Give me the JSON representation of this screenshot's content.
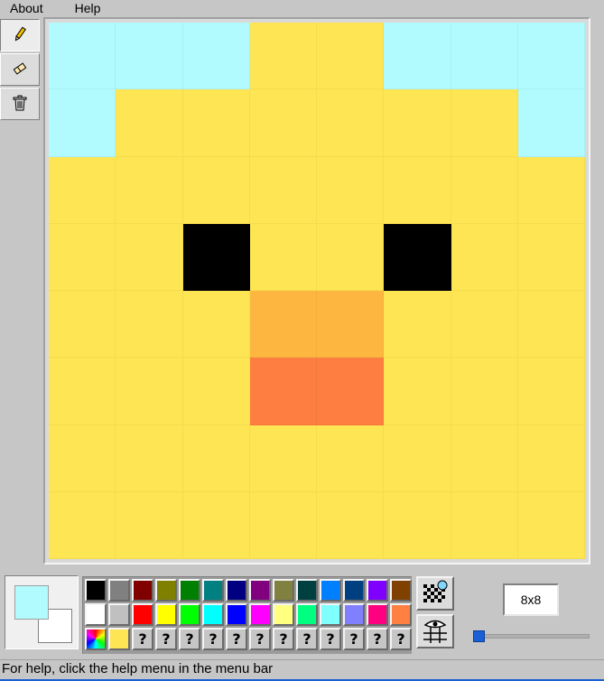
{
  "menu": {
    "items": [
      "About",
      "Help"
    ]
  },
  "tools": [
    "pencil-icon",
    "eraser-icon",
    "trash-icon"
  ],
  "canvas": {
    "size_label": "8x8",
    "colors": {
      "S": "#b1fafd",
      "Y": "#fee553",
      "K": "#000000",
      "O": "#fdb740",
      "R": "#fd7e40"
    },
    "pixels": [
      "SSSYYSSS",
      "SYYYYYYS",
      "YYYYYYYY",
      "YYKYYKYY",
      "YYYOOYYY",
      "YYYRRYYY",
      "YYYYYYYY",
      "YYYYYYYY"
    ]
  },
  "current_colors": {
    "foreground": "#b1fafd",
    "background": "#ffffff"
  },
  "palette": [
    [
      "#000000",
      "#808080",
      "#800000",
      "#808000",
      "#008000",
      "#008080",
      "#000080",
      "#800080",
      "#808040",
      "#004040",
      "#0080ff",
      "#004080",
      "#8000ff",
      "#804000"
    ],
    [
      "#ffffff",
      "#c0c0c0",
      "#ff0000",
      "#ffff00",
      "#00ff00",
      "#00ffff",
      "#0000ff",
      "#ff00ff",
      "#ffff80",
      "#00ff80",
      "#80ffff",
      "#8080ff",
      "#ff0080",
      "#ff8040"
    ],
    [
      "gradient",
      "#fee553",
      "?",
      "?",
      "?",
      "?",
      "?",
      "?",
      "?",
      "?",
      "?",
      "?",
      "?",
      "?"
    ]
  ],
  "side_buttons": [
    "grid-pattern-icon",
    "grid-view-icon"
  ],
  "zoom": {
    "slider_value": 0
  },
  "status": {
    "text": "For help, click the help menu in the menu bar"
  }
}
